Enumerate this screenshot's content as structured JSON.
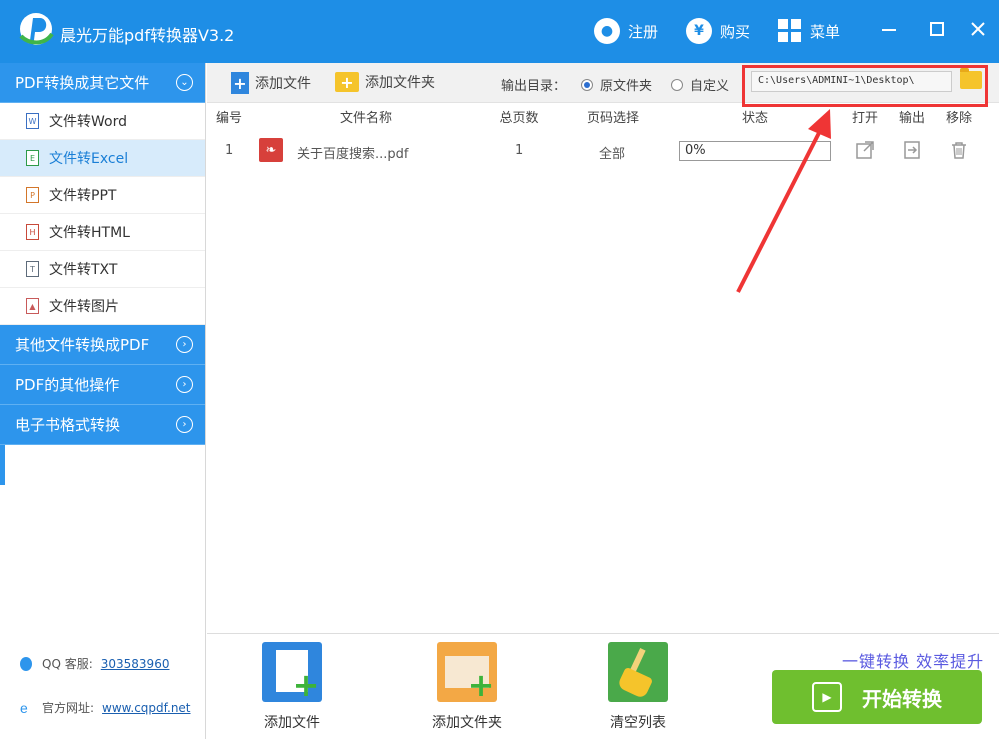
{
  "app": {
    "title": "晨光万能pdf转换器V3.2"
  },
  "titlebar": {
    "register": "注册",
    "buy": "购买",
    "menu": "菜单",
    "buy_symbol": "¥"
  },
  "sidebar": {
    "categories": [
      {
        "label": "PDF转换成其它文件",
        "expanded": true
      },
      {
        "label": "其他文件转换成PDF"
      },
      {
        "label": "PDF的其他操作"
      },
      {
        "label": "电子书格式转换"
      }
    ],
    "items": [
      {
        "label": "文件转Word",
        "icon": "W"
      },
      {
        "label": "文件转Excel",
        "icon": "E"
      },
      {
        "label": "文件转PPT",
        "icon": "P"
      },
      {
        "label": "文件转HTML",
        "icon": "H"
      },
      {
        "label": "文件转TXT",
        "icon": "T"
      },
      {
        "label": "文件转图片",
        "icon": ""
      }
    ],
    "qq_label": "QQ 客服:",
    "qq_value": "303583960",
    "site_label": "官方网址:",
    "site_value": "www.cqpdf.net"
  },
  "toolbar": {
    "add_file": "添加文件",
    "add_folder": "添加文件夹",
    "output_label": "输出目录：",
    "radio_original": "原文件夹",
    "radio_custom": "自定义",
    "path": "C:\\Users\\ADMINI~1\\Desktop\\"
  },
  "table": {
    "headers": [
      "编号",
      "文件名称",
      "总页数",
      "页码选择",
      "状态",
      "打开",
      "输出",
      "移除"
    ],
    "rows": [
      {
        "index": "1",
        "name": "关于百度搜索...pdf",
        "pages": "1",
        "range": "全部",
        "status": "0%"
      }
    ]
  },
  "bottom": {
    "add_file": "添加文件",
    "add_folder": "添加文件夹",
    "clear": "清空列表",
    "slogan": "一键转换 效率提升",
    "start": "开始转换"
  },
  "colors": {
    "primary": "#1e8ee6",
    "start": "#6fbf2f",
    "highlight": "#ef3535"
  }
}
